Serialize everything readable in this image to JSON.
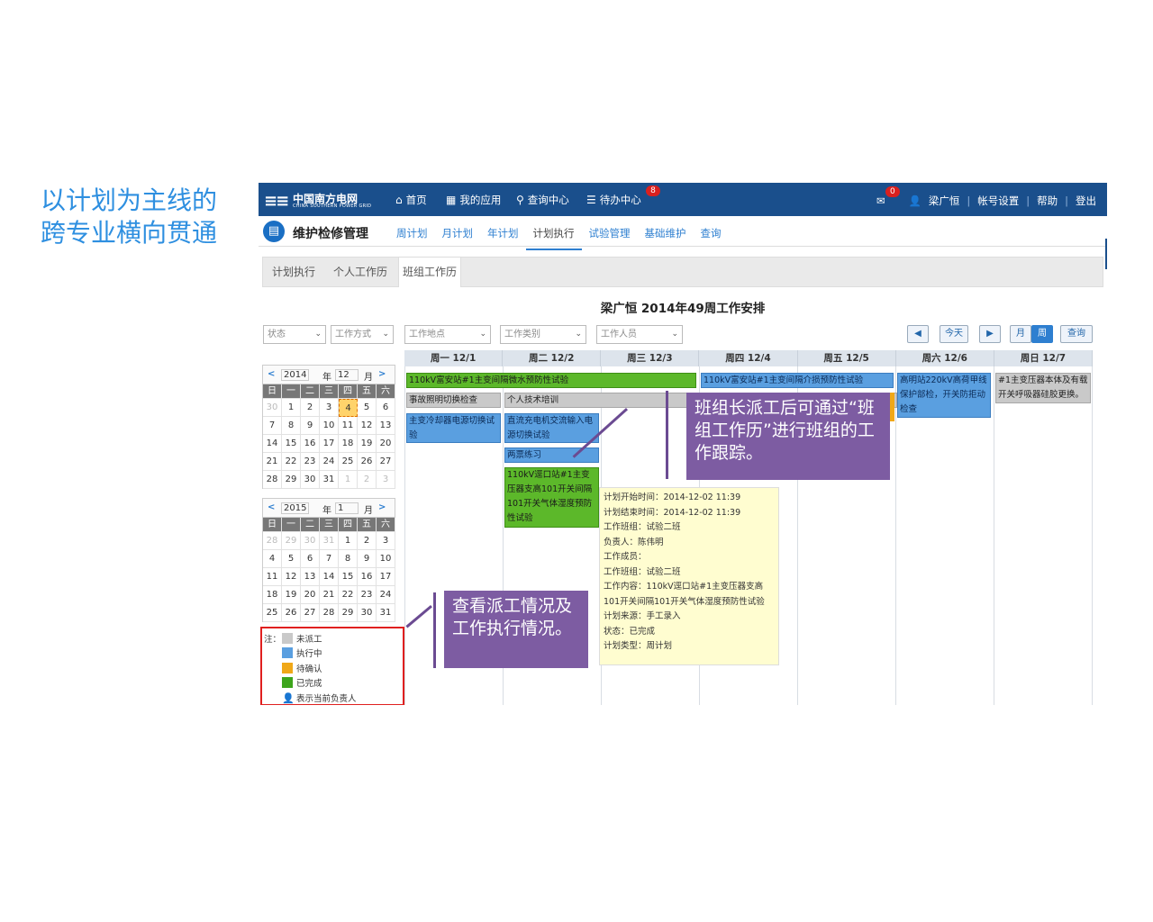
{
  "slide_title": [
    "以计划为主线的",
    "跨专业横向贯通"
  ],
  "app": {
    "logo": {
      "cn": "中国南方电网",
      "en": "CHINA SOUTHERN POWER GRID"
    },
    "nav": [
      {
        "icon": "⌂",
        "label": "首页"
      },
      {
        "icon": "▦",
        "label": "我的应用"
      },
      {
        "icon": "⚲",
        "label": "查询中心"
      },
      {
        "icon": "☰",
        "label": "待办中心",
        "badge": "8"
      }
    ],
    "mail_badge": "0",
    "user": "梁广恒",
    "links": [
      "帐号设置",
      "帮助",
      "登出"
    ]
  },
  "module": {
    "title": "维护检修管理",
    "tabs": [
      "周计划",
      "月计划",
      "年计划",
      "计划执行",
      "试验管理",
      "基础维护",
      "查询"
    ],
    "active_tab": "计划执行"
  },
  "page_tabs": [
    "计划执行",
    "个人工作历",
    "班组工作历"
  ],
  "page_title": "梁广恒 2014年49周工作安排",
  "filters": [
    "状态",
    "工作方式",
    "工作地点",
    "工作类别",
    "工作人员"
  ],
  "controls": {
    "today": "今天",
    "month": "月",
    "week": "周",
    "query": "查询"
  },
  "cal1": {
    "year": "2014",
    "month": "12",
    "year_label": "年",
    "month_label": "月",
    "weekdays": [
      "日",
      "一",
      "二",
      "三",
      "四",
      "五",
      "六"
    ],
    "days": [
      "30",
      "1",
      "2",
      "3",
      "4",
      "5",
      "6",
      "7",
      "8",
      "9",
      "10",
      "11",
      "12",
      "13",
      "14",
      "15",
      "16",
      "17",
      "18",
      "19",
      "20",
      "21",
      "22",
      "23",
      "24",
      "25",
      "26",
      "27",
      "28",
      "29",
      "30",
      "31",
      "1",
      "2",
      "3"
    ]
  },
  "cal2": {
    "year": "2015",
    "month": "1",
    "year_label": "年",
    "month_label": "月",
    "weekdays": [
      "日",
      "一",
      "二",
      "三",
      "四",
      "五",
      "六"
    ],
    "days": [
      "28",
      "29",
      "30",
      "31",
      "1",
      "2",
      "3",
      "4",
      "5",
      "6",
      "7",
      "8",
      "9",
      "10",
      "11",
      "12",
      "13",
      "14",
      "15",
      "16",
      "17",
      "18",
      "19",
      "20",
      "21",
      "22",
      "23",
      "24",
      "25",
      "26",
      "27",
      "28",
      "29",
      "30",
      "31"
    ]
  },
  "legend": {
    "label": "注：",
    "items": [
      {
        "text": "未派工",
        "color": "#c9c9c9"
      },
      {
        "text": "执行中",
        "color": "#5a9fe0"
      },
      {
        "text": "待确认",
        "color": "#f0a818"
      },
      {
        "text": "已完成",
        "color": "#3da51c"
      },
      {
        "text": "表示当前负责人",
        "color": "#2e7fd0"
      }
    ]
  },
  "week_days": [
    "周一 12/1",
    "周二 12/2",
    "周三 12/3",
    "周四 12/4",
    "周五 12/5",
    "周六 12/6",
    "周日 12/7"
  ],
  "events": {
    "e1": "110kV富安站#1主变间隔微水预防性试验",
    "e2": "110kV富安站#1主变间隔介损预防性试验",
    "e3": "高明站220kV高荷甲线保护部检，开关防拒动检查",
    "e4": "#1主变压器本体及有载开关呼吸器硅胶更换。",
    "e5": "事故照明切换检查",
    "e6": "个人技术培训",
    "e7": "主变冷却器电源切换试验",
    "e8": "直流充电机交流输入电源切换试验",
    "e9": "两票练习",
    "e10": "110kV逕口站#1主变压器支高101开关间隔101开关气体湿度预防性试验"
  },
  "tooltip": [
    "计划开始时间：2014-12-02 11:39",
    "计划结束时间：2014-12-02 11:39",
    "工作班组：试验二班",
    "负责人：陈伟明",
    "工作成员：",
    "工作班组：试验二班",
    "工作内容：110kV逕口站#1主变压器支高",
    "101开关间隔101开关气体湿度预防性试验",
    "计划来源：手工录入",
    "状态：已完成",
    "计划类型：周计划"
  ],
  "callouts": {
    "right": "班组长派工后可通过“班组工作历”进行班组的工作跟踪。",
    "left": "查看派工情况及工作执行情况。"
  }
}
